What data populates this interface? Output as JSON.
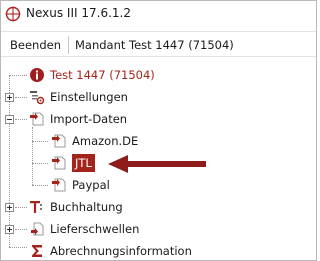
{
  "window": {
    "title": "Nexus III 17.6.1.2"
  },
  "menubar": {
    "quit_label": "Beenden",
    "tenant_label": "Mandant",
    "tenant_value": "Test 1447 (71504)"
  },
  "tree": {
    "root": {
      "label": "Test 1447 (71504)",
      "icon": "info-icon"
    },
    "items": [
      {
        "label": "Einstellungen",
        "icon": "settings-list-icon",
        "expander": "plus"
      },
      {
        "label": "Import-Daten",
        "icon": "import-icon",
        "expander": "minus",
        "children": [
          {
            "label": "Amazon.DE",
            "icon": "import-icon"
          },
          {
            "label": "JTL",
            "icon": "import-icon",
            "selected": true
          },
          {
            "label": "Paypal",
            "icon": "import-icon"
          }
        ]
      },
      {
        "label": "Buchhaltung",
        "icon": "accounting-icon",
        "expander": "plus"
      },
      {
        "label": "Lieferschwellen",
        "icon": "delivery-threshold-icon",
        "expander": "plus"
      },
      {
        "label": "Abrechnungsinformation",
        "icon": "sigma-icon"
      }
    ]
  },
  "colors": {
    "accent": "#a3241a",
    "arrow": "#8e1c1c",
    "text": "#1a1a1a"
  }
}
